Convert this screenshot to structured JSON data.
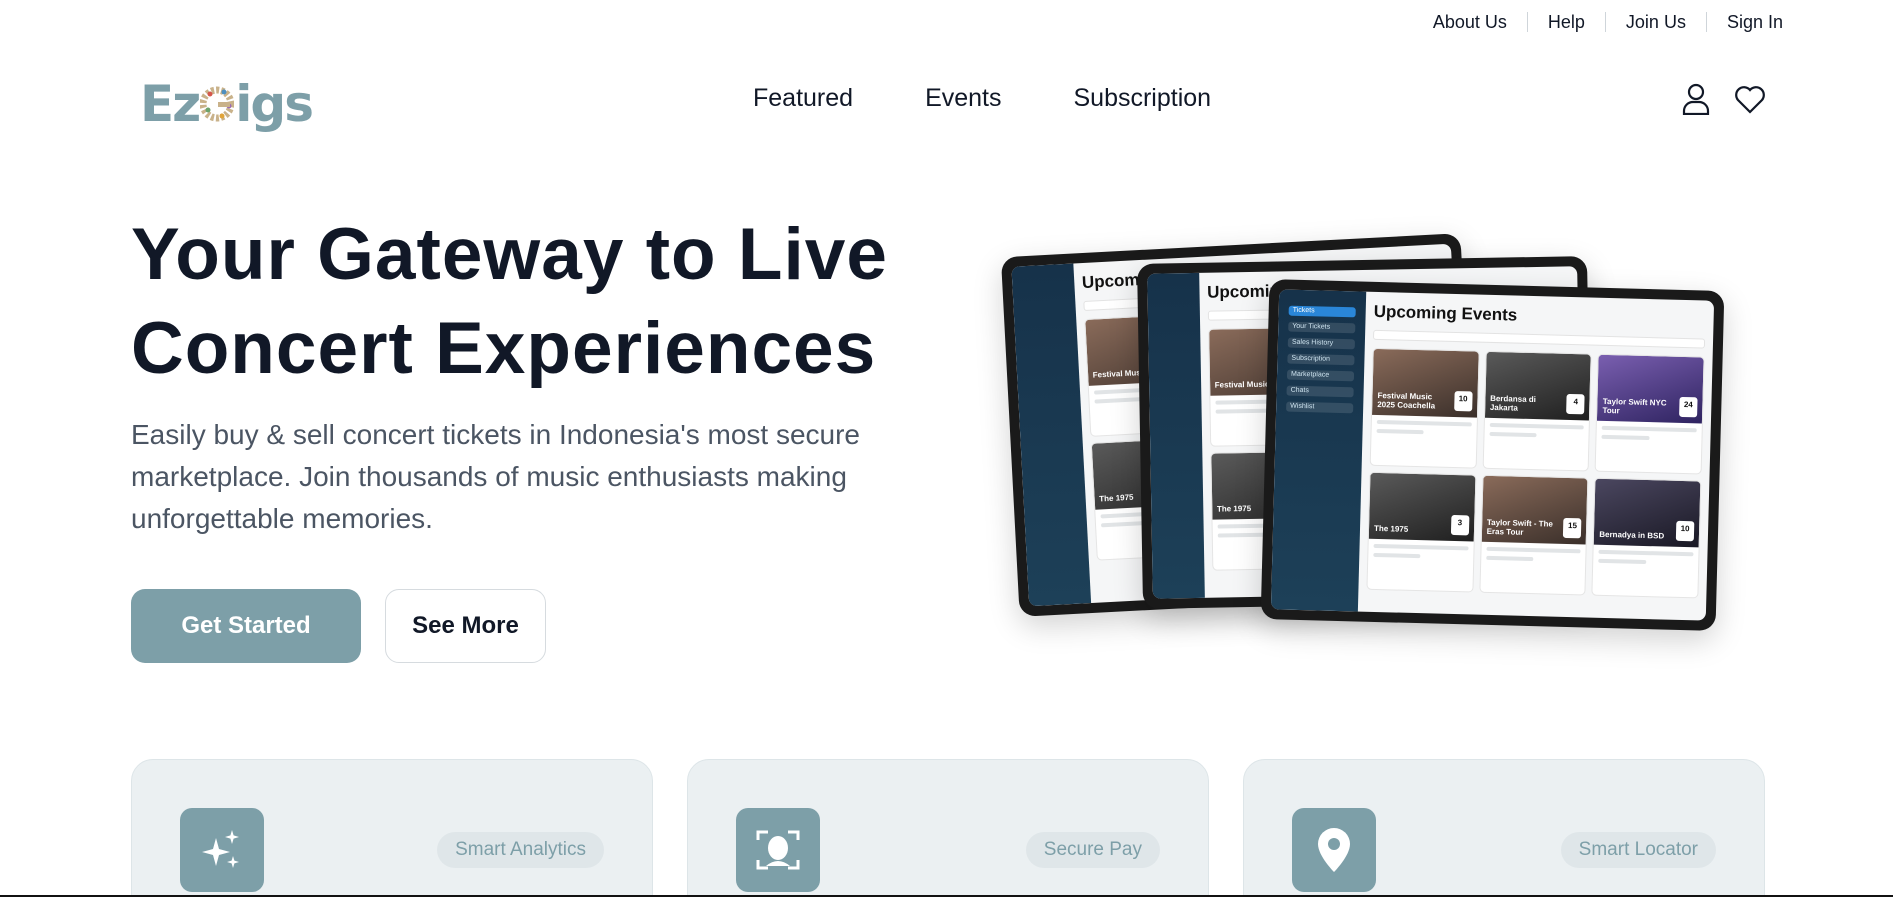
{
  "utility_nav": {
    "items": [
      "About Us",
      "Help",
      "Join Us",
      "Sign In"
    ]
  },
  "brand": {
    "logo_text_left": "Ez",
    "logo_text_right": "igs",
    "accent_color": "#7d9fa8"
  },
  "main_nav": {
    "items": [
      "Featured",
      "Events",
      "Subscription"
    ],
    "icons": [
      "user-icon",
      "heart-icon"
    ]
  },
  "hero": {
    "title_line1": "Your Gateway to Live",
    "title_line2": "Concert Experiences",
    "subtitle": "Easily buy & sell concert tickets in Indonesia's most secure marketplace. Join thousands of music enthusiasts making unforgettable memories.",
    "primary_button": "Get Started",
    "secondary_button": "See More"
  },
  "mockup": {
    "screen_title": "Upcoming Events",
    "screen_title_short": "Upcoming",
    "sidebar_items": [
      "Tickets",
      "Your Tickets",
      "Sales History",
      "Subscription",
      "Marketplace",
      "Chats",
      "Wishlist"
    ],
    "events": [
      {
        "name": "Festival Music 2025 Coachella",
        "day": "10"
      },
      {
        "name": "Berdansa di Jakarta",
        "day": "4"
      },
      {
        "name": "Taylor Swift NYC Tour",
        "day": "24"
      },
      {
        "name": "The 1975",
        "day": "3"
      },
      {
        "name": "Taylor Swift - The Eras Tour",
        "day": "15"
      },
      {
        "name": "Bernadya in BSD",
        "day": "10"
      }
    ],
    "back_events": [
      "Festival Music 2025 Coachella",
      "The 1975"
    ]
  },
  "features": [
    {
      "icon": "sparkles-icon",
      "badge": "Smart Analytics"
    },
    {
      "icon": "face-scan-icon",
      "badge": "Secure Pay"
    },
    {
      "icon": "location-pin-icon",
      "badge": "Smart Locator"
    }
  ]
}
